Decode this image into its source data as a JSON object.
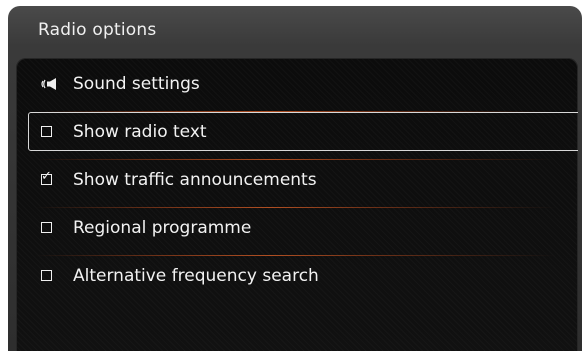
{
  "title": "Radio options",
  "menu": {
    "items": [
      {
        "label": "Sound settings",
        "icon": "speaker-icon",
        "type": "submenu"
      },
      {
        "label": "Show radio text",
        "icon": "checkbox-icon",
        "checked": false,
        "selected": true
      },
      {
        "label": "Show traffic announcements",
        "icon": "checkbox-icon",
        "checked": true
      },
      {
        "label": "Regional programme",
        "icon": "checkbox-icon",
        "checked": false
      },
      {
        "label": "Alternative frequency search",
        "icon": "checkbox-icon",
        "checked": false
      }
    ]
  },
  "colors": {
    "separator_accent": "#e0642a",
    "text": "#f2f2f2",
    "panel_bg": "#0e0e0e",
    "frame_bg": "#3a3a3a"
  }
}
